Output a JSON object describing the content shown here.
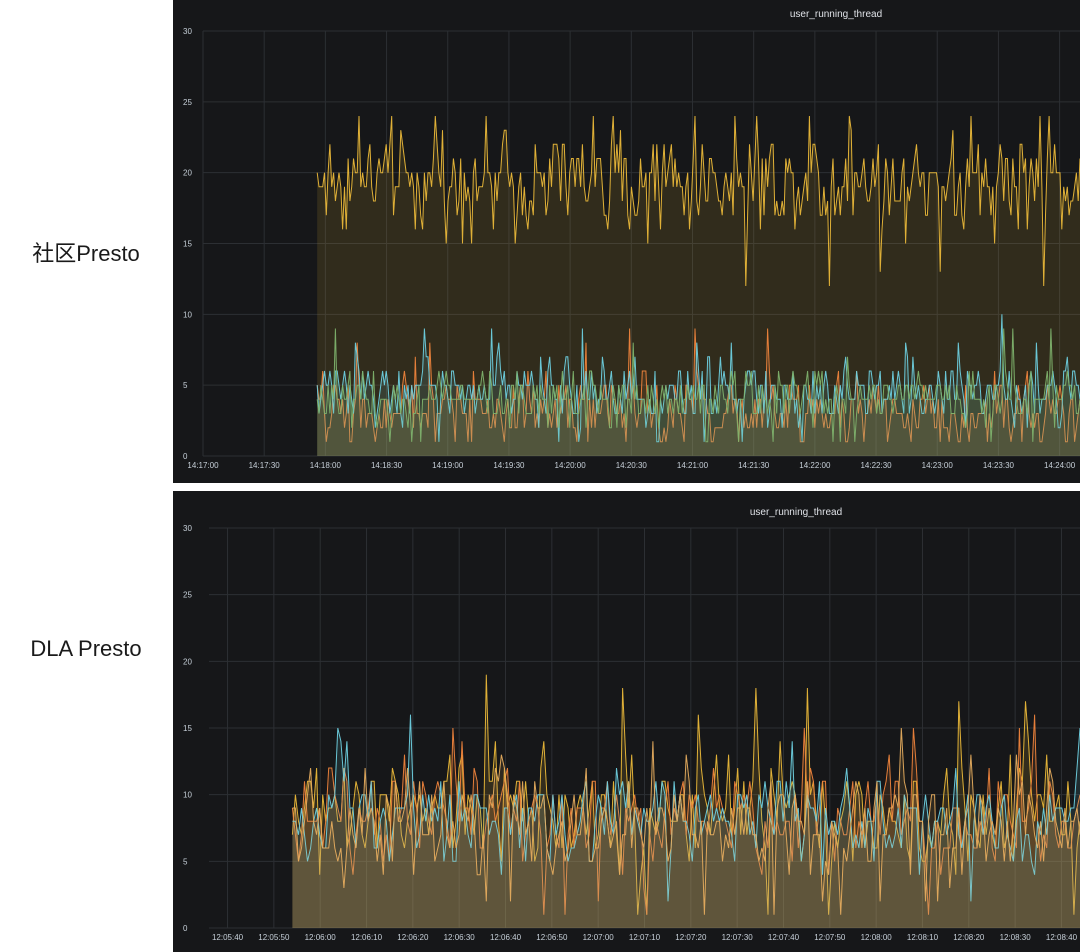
{
  "labels": {
    "top": "社区Presto",
    "bottom": "DLA Presto"
  },
  "colors": {
    "panel_bg": "#161719",
    "grid": "#2c2f33",
    "axis_text": "#c7d0d9",
    "series": [
      "#eab839",
      "#ef843c",
      "#6ed0e0",
      "#7eb26d",
      "#e5ac5e"
    ]
  },
  "chart_data": [
    {
      "type": "area",
      "title": "user_running_thread",
      "xlabel": "",
      "ylabel": "",
      "ylim": [
        0,
        30
      ],
      "yticks": [
        0,
        5,
        10,
        15,
        20,
        25,
        30
      ],
      "xticks": [
        "14:17:00",
        "14:17:30",
        "14:18:00",
        "14:18:30",
        "14:19:00",
        "14:19:30",
        "14:20:00",
        "14:20:30",
        "14:21:00",
        "14:21:30",
        "14:22:00",
        "14:22:30",
        "14:23:00",
        "14:23:30",
        "14:24:00"
      ],
      "x_start": "14:17:00",
      "x_end": "14:24:10",
      "grid": true,
      "data_start": "14:17:56",
      "series": [
        {
          "color": "#eab839",
          "mean": 19.5,
          "spread": 2.5,
          "min": 12,
          "max": 24,
          "fill_opacity": 0.13
        },
        {
          "color": "#ef843c",
          "mean": 3.2,
          "spread": 1.8,
          "min": 1,
          "max": 10,
          "fill_opacity": 0.12
        },
        {
          "color": "#6ed0e0",
          "mean": 4.6,
          "spread": 1.5,
          "min": 1,
          "max": 11,
          "fill_opacity": 0.12
        },
        {
          "color": "#7eb26d",
          "mean": 4.2,
          "spread": 1.4,
          "min": 1,
          "max": 9,
          "fill_opacity": 0.12
        }
      ]
    },
    {
      "type": "area",
      "title": "user_running_thread",
      "xlabel": "",
      "ylabel": "",
      "ylim": [
        0,
        30
      ],
      "yticks": [
        0,
        5,
        10,
        15,
        20,
        25,
        30
      ],
      "xticks": [
        "12:05:40",
        "12:05:50",
        "12:06:00",
        "12:06:10",
        "12:06:20",
        "12:06:30",
        "12:06:40",
        "12:06:50",
        "12:07:00",
        "12:07:10",
        "12:07:20",
        "12:07:30",
        "12:07:40",
        "12:07:50",
        "12:08:00",
        "12:08:10",
        "12:08:20",
        "12:08:30",
        "12:08:40"
      ],
      "x_start": "12:05:36",
      "x_end": "12:08:44",
      "grid": true,
      "data_start": "12:05:54",
      "series": [
        {
          "color": "#eab839",
          "mean": 8.5,
          "spread": 3.2,
          "min": 1,
          "max": 24,
          "fill_opacity": 0.14
        },
        {
          "color": "#ef843c",
          "mean": 8,
          "spread": 2.6,
          "min": 1,
          "max": 16,
          "fill_opacity": 0.12
        },
        {
          "color": "#6ed0e0",
          "mean": 8.2,
          "spread": 2.4,
          "min": 2,
          "max": 16,
          "fill_opacity": 0.12
        },
        {
          "color": "#e5ac5e",
          "mean": 8,
          "spread": 2.8,
          "min": 1,
          "max": 20,
          "fill_opacity": 0.12
        }
      ]
    }
  ]
}
